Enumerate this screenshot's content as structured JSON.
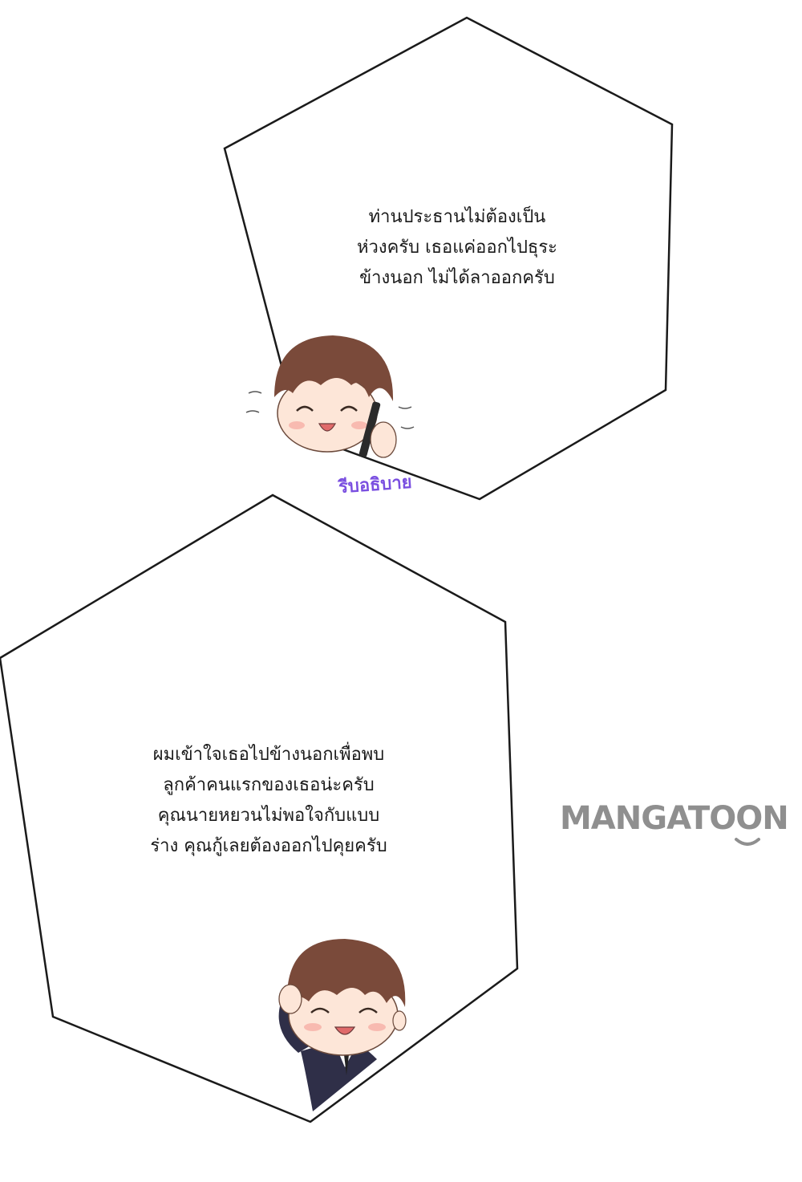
{
  "panels": [
    {
      "id": "panel-top",
      "dialogue": "ท่านประธานไม่ต้องเป็น\nห่วงครับ เธอแค่ออกไปธุระ\nข้างนอก ไม่ได้ลาออกครับ",
      "sfx": "รีบอธิบาย"
    },
    {
      "id": "panel-bottom",
      "dialogue": "ผมเข้าใจเธอไปข้างนอกเพื่อพบ\nลูกค้าคนแรกของเธอน่ะครับ\nคุณนายหยวนไม่พอใจกับแบบ\nร่าง คุณกู้เลยต้องออกไปคุยครับ"
    }
  ],
  "watermark": "MANGATOON",
  "colors": {
    "background": "#ffffff",
    "panel_border": "#1a1a1a",
    "hair": "#7a4a3a",
    "skin": "#fde6d8",
    "blush": "#f5a6a0",
    "suit": "#2f2f48",
    "sfx_text": "#7a4fe0",
    "watermark": "#8f8f8f"
  },
  "icons": [
    "chibi-character-phone-icon",
    "chibi-character-thinking-icon",
    "smile-logo-icon"
  ]
}
